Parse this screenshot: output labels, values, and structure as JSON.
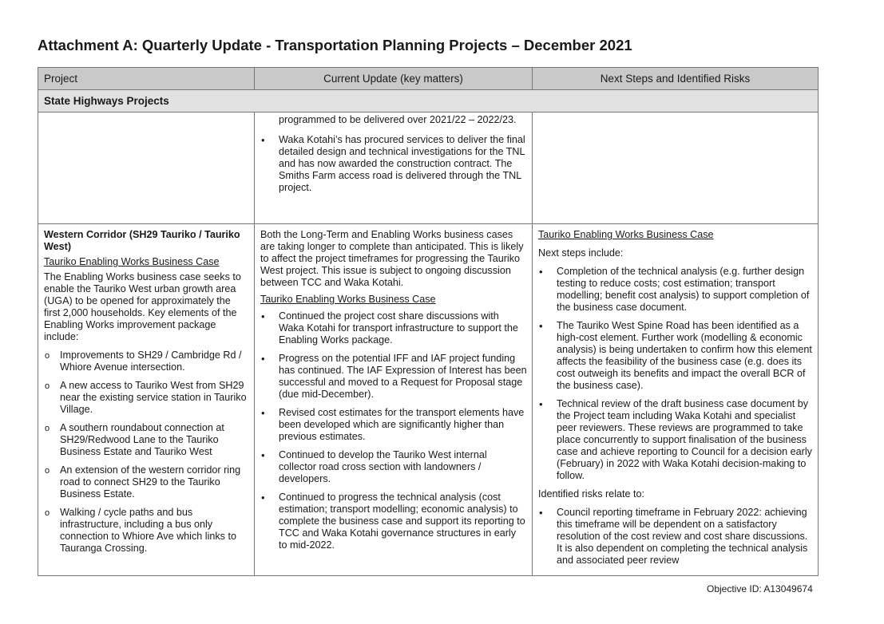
{
  "title": "Attachment A: Quarterly Update - Transportation Planning Projects – December 2021",
  "headers": [
    "Project",
    "Current Update (key matters)",
    "Next Steps and Identified Risks"
  ],
  "section": "State Highways Projects",
  "row1": {
    "update": [
      "programmed to be delivered over 2021/22 – 2022/23.",
      "Waka Kotahi’s has procured services to deliver the final detailed design and technical investigations for the TNL and has now awarded the construction contract. The Smiths Farm access road is delivered through the TNL project."
    ]
  },
  "row2": {
    "project": {
      "name": "Western Corridor (SH29 Tauriko / Tauriko West)",
      "subheading": "Tauriko Enabling Works Business Case",
      "intro": "The Enabling Works business case seeks to enable the Tauriko West urban growth area (UGA) to be opened for approximately the first 2,000 households. Key elements of the Enabling Works improvement package include:",
      "elements": [
        "Improvements to SH29 / Cambridge Rd / Whiore Avenue intersection.",
        "A new access to Tauriko West from SH29 near the existing service station in Tauriko Village.",
        "A southern roundabout connection at SH29/Redwood Lane to the Tauriko Business Estate and Tauriko West",
        "An extension of the western corridor ring road to connect SH29 to the Tauriko Business Estate.",
        "Walking / cycle paths and bus infrastructure, including a bus only connection to Whiore Ave which links to Tauranga Crossing."
      ]
    },
    "update": {
      "intro": "Both the Long-Term and Enabling Works business cases are taking longer to complete than anticipated. This is likely to affect the project timeframes for progressing the Tauriko West project. This issue is subject to ongoing discussion between TCC and Waka Kotahi.",
      "subheading": "Tauriko Enabling Works Business Case",
      "items": [
        "Continued the project cost share discussions with Waka Kotahi for transport infrastructure to support the Enabling Works package.",
        "Progress on the potential IFF and IAF project funding has continued. The IAF Expression of Interest has been successful and moved to a Request for Proposal stage (due mid-December).",
        "Revised cost estimates for the transport elements have been developed which are significantly higher than previous estimates.",
        "Continued to develop the Tauriko West internal collector road cross section with landowners / developers.",
        "Continued to progress the technical analysis (cost estimation; transport modelling; economic analysis) to complete the business case and support its reporting to TCC and Waka Kotahi governance structures in early to mid-2022."
      ]
    },
    "next": {
      "subheading": "Tauriko Enabling Works Business Case",
      "steps_label": "Next steps include:",
      "steps": [
        "Completion of the technical analysis (e.g. further design testing to reduce costs; cost estimation; transport modelling; benefit cost analysis) to support completion of the business case document.",
        "The Tauriko West Spine Road has been identified as a high-cost element. Further work (modelling & economic analysis) is being undertaken to confirm how this element affects the feasibility of the business case (e.g. does its cost outweigh its benefits and impact the overall BCR of the business case).",
        "Technical review of the draft business case document by the Project team including Waka Kotahi and specialist peer reviewers. These reviews are programmed to take place concurrently to support finalisation of the business case and achieve reporting to Council for a decision early (February) in 2022 with Waka Kotahi decision-making to follow."
      ],
      "risks_label": "Identified risks relate to:",
      "risks": [
        "Council reporting timeframe in February 2022: achieving this timeframe will be dependent on a satisfactory resolution of the cost review and cost share discussions. It is also dependent on completing the technical analysis and associated peer review"
      ]
    }
  },
  "footer": "Objective ID:  A13049674"
}
